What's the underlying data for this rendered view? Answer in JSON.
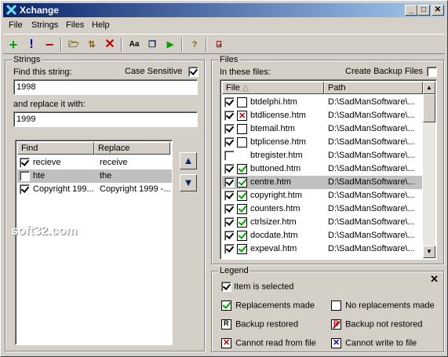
{
  "window": {
    "title": "Xchange"
  },
  "menu": [
    "File",
    "Strings",
    "Files",
    "Help"
  ],
  "toolbar_icons": [
    "add-icon",
    "exclamation-icon",
    "remove-icon",
    "open-icon",
    "sort-icon",
    "delete-icon",
    "font-case-icon",
    "copy-icon",
    "run-icon",
    "help-icon",
    "exit-icon"
  ],
  "strings": {
    "group_title": "Strings",
    "find_label": "Find this string:",
    "case_sensitive_label": "Case Sensitive",
    "case_sensitive": true,
    "find_value": "1998",
    "replace_label": "and replace it with:",
    "replace_value": "1999",
    "columns": [
      "Find",
      "Replace"
    ],
    "rows": [
      {
        "checked": true,
        "find": "recieve",
        "replace": "receive"
      },
      {
        "checked": false,
        "find": "hte",
        "replace": "the",
        "selected": true
      },
      {
        "checked": true,
        "find": "Copyright 199...",
        "replace": "Copyright 1999 -..."
      }
    ]
  },
  "files": {
    "group_title": "Files",
    "in_files_label": "In these files:",
    "create_backup_label": "Create Backup Files",
    "create_backup": false,
    "columns": [
      "File",
      "Path"
    ],
    "rows": [
      {
        "sel": true,
        "status": "",
        "name": "btdelphi.htm",
        "path": "D:\\SadManSoftware\\..."
      },
      {
        "sel": true,
        "status": "x",
        "name": "btdlicense.htm",
        "path": "D:\\SadManSoftware\\..."
      },
      {
        "sel": true,
        "status": "",
        "name": "btemail.htm",
        "path": "D:\\SadManSoftware\\..."
      },
      {
        "sel": true,
        "status": "",
        "name": "btplicense.htm",
        "path": "D:\\SadManSoftware\\..."
      },
      {
        "sel": false,
        "status": "none",
        "name": "btregister.htm",
        "path": "D:\\SadManSoftware\\..."
      },
      {
        "sel": true,
        "status": "ok",
        "name": "buttoned.htm",
        "path": "D:\\SadManSoftware\\..."
      },
      {
        "sel": true,
        "status": "ok",
        "name": "centre.htm",
        "path": "D:\\SadManSoftware\\...",
        "selected": true
      },
      {
        "sel": true,
        "status": "ok",
        "name": "copyright.htm",
        "path": "D:\\SadManSoftware\\..."
      },
      {
        "sel": true,
        "status": "ok",
        "name": "counters.htm",
        "path": "D:\\SadManSoftware\\..."
      },
      {
        "sel": true,
        "status": "ok",
        "name": "ctrlsizer.htm",
        "path": "D:\\SadManSoftware\\..."
      },
      {
        "sel": true,
        "status": "ok",
        "name": "docdate.htm",
        "path": "D:\\SadManSoftware\\..."
      },
      {
        "sel": true,
        "status": "ok",
        "name": "expeval.htm",
        "path": "D:\\SadManSoftware\\..."
      }
    ]
  },
  "legend": {
    "title": "Legend",
    "items": [
      {
        "icon": "check",
        "label": "Item is selected"
      },
      {
        "icon": "ok",
        "label": "Replacements made"
      },
      {
        "icon": "empty",
        "label": "No replacements made"
      },
      {
        "icon": "r",
        "label": "Backup restored"
      },
      {
        "icon": "rx",
        "label": "Backup not restored"
      },
      {
        "icon": "x",
        "label": "Cannot read from file"
      },
      {
        "icon": "bx",
        "label": "Cannot write to file"
      }
    ]
  },
  "watermark": "soft32.com"
}
